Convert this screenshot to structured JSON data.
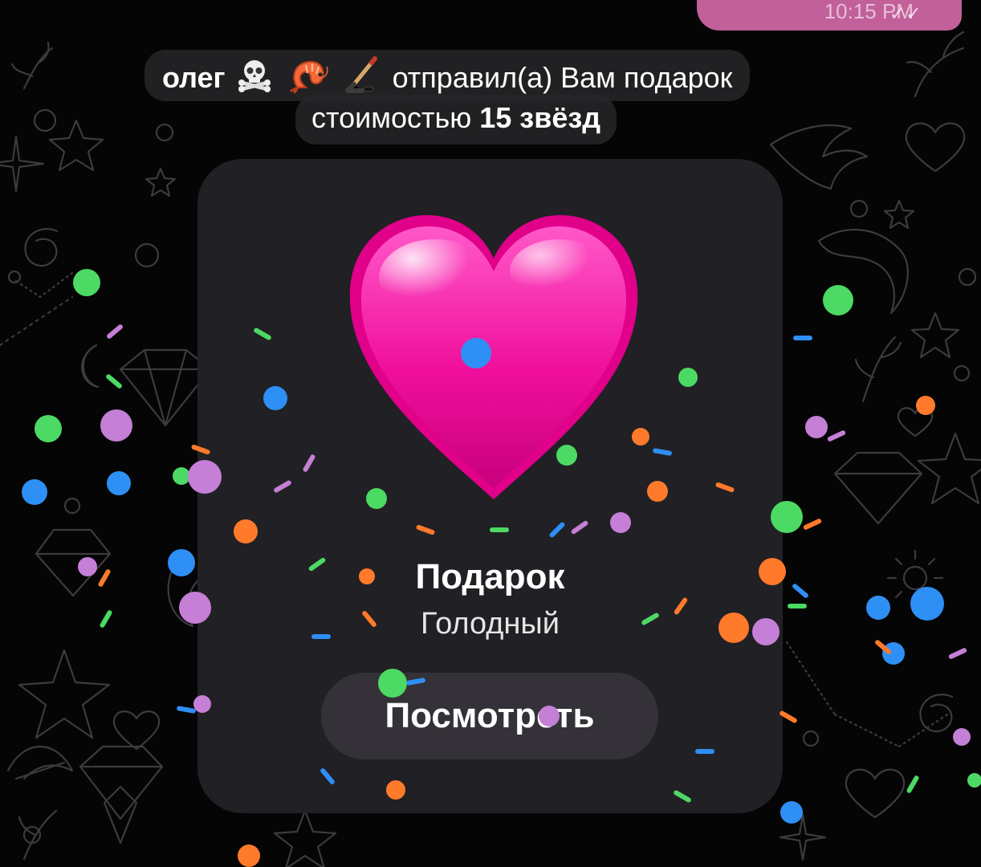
{
  "background": {
    "color": "#050505",
    "pattern": "doodle-wallpaper",
    "doodle_color": "#3a3a3e"
  },
  "previous_message": {
    "time": "10:15 PM",
    "status_icon": "double-check-icon",
    "bubble_color": "#c2609a"
  },
  "service_message": {
    "sender_name": "олег",
    "sender_emoji": [
      "skull-crossbones-icon",
      "shrimp-icon",
      "hockey-stick-icon"
    ],
    "action_text": "отправил(а) Вам подарок",
    "cost_prefix": "стоимостью",
    "cost_amount": "15 звёзд"
  },
  "gift": {
    "icon": "pink-heart-icon",
    "heart_color": "#ff1fa8",
    "title": "Подарок",
    "name": "Голодный",
    "button_label": "Посмотреть"
  },
  "confetti_colors": {
    "green": "#4cd964",
    "blue": "#2e8ff5",
    "orange": "#ff7a2b",
    "purple": "#c57fd6"
  }
}
